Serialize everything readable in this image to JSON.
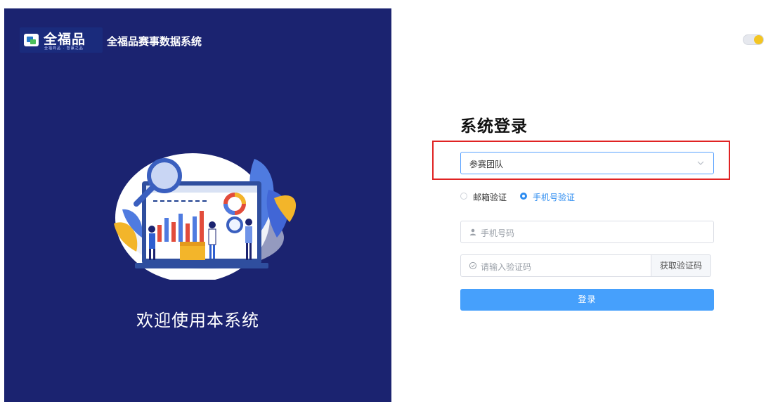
{
  "brand": {
    "logo_text": "全福品",
    "logo_subtext": "全福商品 · 智赢之品",
    "system_name": "全福品赛事数据系统"
  },
  "left_panel": {
    "welcome": "欢迎使用本系统"
  },
  "login": {
    "title": "系统登录",
    "role_select_value": "参赛团队",
    "verify_methods": [
      {
        "label": "邮箱验证",
        "selected": false
      },
      {
        "label": "手机号验证",
        "selected": true
      }
    ],
    "phone_placeholder": "手机号码",
    "code_placeholder": "请输入验证码",
    "get_code_label": "获取验证码",
    "submit_label": "登录"
  },
  "colors": {
    "left_bg": "#1b2370",
    "primary": "#2d8cf0",
    "login_button": "#46a0fc",
    "highlight": "#e02323"
  },
  "icons": [
    "user-icon",
    "check-circle-icon",
    "chevron-down-icon"
  ]
}
